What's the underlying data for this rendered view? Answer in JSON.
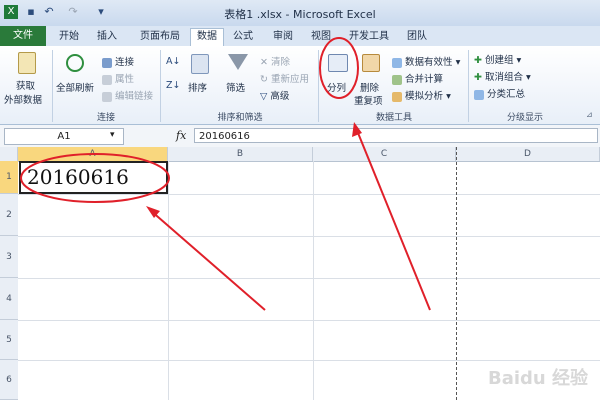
{
  "window": {
    "title": "表格1 .xlsx - Microsoft Excel"
  },
  "tabs": [
    "文件",
    "开始",
    "插入",
    "页面布局",
    "数据",
    "公式",
    "审阅",
    "视图",
    "开发工具",
    "团队"
  ],
  "ribbon": {
    "get_external": {
      "line1": "获取",
      "line2": "外部数据"
    },
    "connections": {
      "refresh_all": "全部刷新",
      "connections": "连接",
      "properties": "属性",
      "edit_links": "编辑链接",
      "label": "连接"
    },
    "sort_filter": {
      "sort": "排序",
      "filter": "筛选",
      "clear": "清除",
      "reapply": "重新应用",
      "advanced": "高级",
      "label": "排序和筛选"
    },
    "data_tools": {
      "text_to_columns": "分列",
      "remove_dup_1": "删除",
      "remove_dup_2": "重复项",
      "validation": "数据有效性",
      "consolidate": "合并计算",
      "what_if": "模拟分析",
      "label": "数据工具"
    },
    "outline": {
      "group": "创建组",
      "ungroup": "取消组合",
      "subtotal": "分类汇总",
      "label": "分级显示"
    }
  },
  "formula_bar": {
    "name_box": "A1",
    "fx": "fx",
    "value": "20160616"
  },
  "columns": [
    "A",
    "B",
    "C",
    "D"
  ],
  "rows": [
    "1",
    "2",
    "3",
    "4",
    "5",
    "6"
  ],
  "cells": {
    "A1": "20160616"
  },
  "watermark": "Baidu 经验",
  "colors": {
    "file_tab": "#2a7a3a",
    "annotation": "#e0202a"
  }
}
